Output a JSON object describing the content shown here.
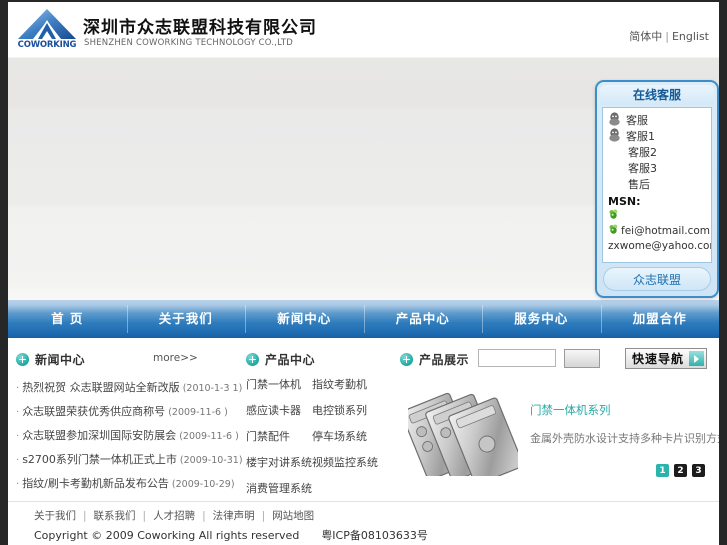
{
  "header": {
    "logo_word": "COWORKING",
    "brand_cn": "深圳市众志联盟科技有限公司",
    "brand_en": "SHENZHEN COWORKING TECHNOLOGY CO.,LTD",
    "lang_cn": "简体中",
    "lang_sep": "|",
    "lang_en": "Englist"
  },
  "service_panel": {
    "title": "在线客服",
    "contacts": [
      {
        "icon": "qq-icon",
        "label": "客服",
        "indent": false
      },
      {
        "icon": "qq-icon",
        "label": "客服1",
        "indent": false
      },
      {
        "icon": "none",
        "label": "客服2",
        "indent": true
      },
      {
        "icon": "none",
        "label": "客服3",
        "indent": true
      },
      {
        "icon": "none",
        "label": "售后",
        "indent": true
      }
    ],
    "msn_label": "MSN:",
    "msn_entries": [
      {
        "icon": "msn-icon",
        "text": ""
      },
      {
        "icon": "msn-icon",
        "text": "fei@hotmail.com"
      },
      {
        "icon": "none",
        "text": "zxwome@yahoo.com.cn"
      }
    ],
    "footer_label": "众志联盟"
  },
  "nav": {
    "items": [
      {
        "label": "首 页"
      },
      {
        "label": "关于我们"
      },
      {
        "label": "新闻中心"
      },
      {
        "label": "产品中心"
      },
      {
        "label": "服务中心"
      },
      {
        "label": "加盟合作"
      }
    ]
  },
  "news": {
    "title": "新闻中心",
    "more_label": "more>>",
    "items": [
      {
        "title": "热烈祝贺 众志联盟网站全新改版",
        "date": "(2010-1-3 1)"
      },
      {
        "title": "众志联盟荣获优秀供应商称号",
        "date": "(2009-11-6 )"
      },
      {
        "title": "众志联盟参加深圳国际安防展会",
        "date": "(2009-11-6 )"
      },
      {
        "title": "s2700系列门禁一体机正式上市",
        "date": "(2009-10-31)"
      },
      {
        "title": "指纹/刷卡考勤机新品发布公告",
        "date": "(2009-10-29)"
      }
    ]
  },
  "quick_links": {
    "title": "产品中心",
    "items": [
      "门禁一体机",
      "指纹考勤机",
      "感应读卡器",
      "电控锁系列",
      "门禁配件",
      "停车场系统",
      "楼宇对讲系统",
      "视频监控系统",
      "消费管理系统"
    ]
  },
  "products": {
    "title": "产品展示",
    "search_value": "",
    "search_placeholder": "",
    "search_button_label": "",
    "quick_nav_label": "快速导航",
    "featured": {
      "image_alt": "door-access-controller-photo",
      "title": "门禁一体机系列",
      "description": "金属外壳防水设计支持多种卡片识别方式"
    },
    "pages": [
      {
        "label": "1",
        "active": true
      },
      {
        "label": "2",
        "active": false
      },
      {
        "label": "3",
        "active": false
      }
    ]
  },
  "footer": {
    "links": [
      "关于我们",
      "联系我们",
      "人才招聘",
      "法律声明",
      "网站地图"
    ],
    "separator": "|",
    "copyright": "Copyright © 2009 Coworking All rights reserved",
    "icp": "粤ICP备08103633号"
  }
}
